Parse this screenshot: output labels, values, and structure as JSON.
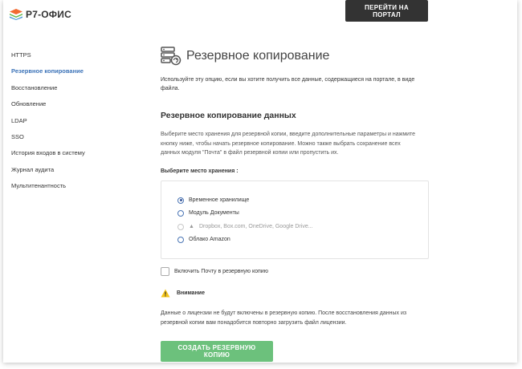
{
  "header": {
    "logo_text": "Р7-ОФИС",
    "portal_button": "ПЕРЕЙТИ НА ПОРТАЛ"
  },
  "sidebar": {
    "items": [
      {
        "label": "HTTPS",
        "active": false
      },
      {
        "label": "Резервное копирование",
        "active": true
      },
      {
        "label": "Восстановление",
        "active": false
      },
      {
        "label": "Обновление",
        "active": false
      },
      {
        "label": "LDAP",
        "active": false
      },
      {
        "label": "SSO",
        "active": false
      },
      {
        "label": "История входов в систему",
        "active": false
      },
      {
        "label": "Журнал аудита",
        "active": false
      },
      {
        "label": "Мультитенантность",
        "active": false
      }
    ]
  },
  "main": {
    "title": "Резервное копирование",
    "intro": "Используйте эту опцию, если вы хотите получить все данные, содержащиеся на портале, в виде файла.",
    "section_title": "Резервное копирование данных",
    "description": "Выберите место хранения для резервной копии, введите дополнительные параметры и нажмите кнопку ниже, чтобы начать резервное копирование. Можно также выбрать сохранение всех данных модуля \"Почта\" в файл резервной копии или пропустить их.",
    "storage_label": "Выберите место хранения :",
    "storage_options": [
      {
        "label": "Временное хранилище",
        "checked": true,
        "disabled": false
      },
      {
        "label": "Модуль Документы",
        "checked": false,
        "disabled": false
      },
      {
        "label": "Dropbox, Box.com, OneDrive, Google Drive...",
        "checked": false,
        "disabled": true
      },
      {
        "label": "Облако Amazon",
        "checked": false,
        "disabled": false
      }
    ],
    "include_mail_label": "Включить Почту в резервную копию",
    "attention_label": "Внимание",
    "notice": "Данные о лицензии не будут включены в резервную копию. После восстановления данных из резервной копии вам понадобится повторно загрузить файл лицензии.",
    "create_button": "СОЗДАТЬ РЕЗЕРВНУЮ КОПИЮ"
  },
  "colors": {
    "accent_link": "#3c73b8",
    "header_button": "#333333",
    "create_button": "#6cc17c",
    "warning": "#f5c518"
  }
}
